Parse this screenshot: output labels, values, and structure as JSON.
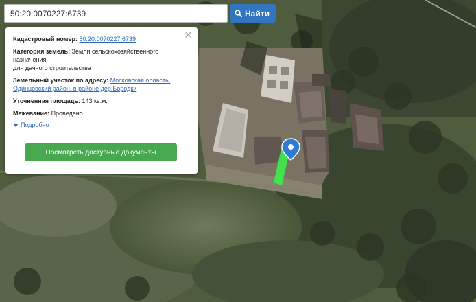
{
  "search": {
    "value": "50:20:0070227:6739",
    "button_label": "Найти"
  },
  "info": {
    "cadastral_label": "Кадастровый номер:",
    "cadastral_value": "50:20:0070227:6739",
    "category_label": "Категория земель:",
    "category_value_line1": "Земли сельскохозяйственного",
    "category_value_line2": "назначения",
    "category_value_line3": "для дачного строительства",
    "address_label": "Земельный участок по адресу:",
    "address_link_line1": "Московская область,",
    "address_link_line2": "Одинцовский район, в районе дер.Бородки",
    "area_label": "Уточненная площадь:",
    "area_value": "143 кв.м.",
    "survey_label": "Межевание:",
    "survey_value": "Проведено",
    "details_label": "Подробно",
    "docs_button_label": "Посмотреть доступные документы"
  },
  "colors": {
    "search_button": "#3275bf",
    "docs_button": "#46a84f",
    "link": "#2a66b8",
    "parcel_highlight": "#3ee84c",
    "marker": "#2d7bd6"
  },
  "icons": {
    "search_button": "search-icon",
    "close": "close-icon",
    "details": "caret-down-icon",
    "marker": "map-marker-icon"
  }
}
